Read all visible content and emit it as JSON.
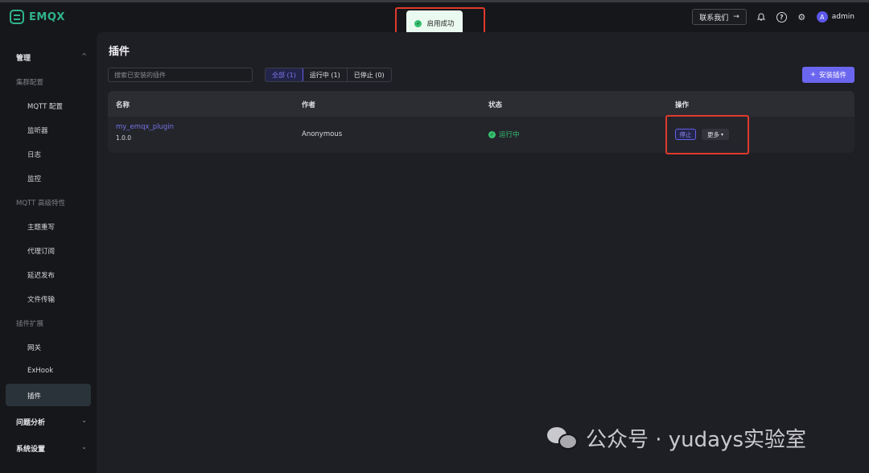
{
  "app": {
    "name": "EMQX"
  },
  "header": {
    "contact_label": "联系我们",
    "user": "admin",
    "avatar_letter": "A"
  },
  "toast": {
    "message": "启用成功"
  },
  "sidebar": {
    "group_manage": "管理",
    "section_cluster": "集群配置",
    "items_cluster": [
      "MQTT 配置",
      "监听器",
      "日志",
      "监控"
    ],
    "section_mqtt": "MQTT 高级特性",
    "items_mqtt": [
      "主题重写",
      "代理订阅",
      "延迟发布",
      "文件传输"
    ],
    "section_plugins": "插件扩展",
    "items_plugins": [
      "网关",
      "ExHook",
      "插件"
    ],
    "active": "插件",
    "group_analysis": "问题分析",
    "group_settings": "系统设置"
  },
  "main": {
    "title": "插件",
    "search_placeholder": "搜索已安装的插件",
    "tabs": [
      "全部 (1)",
      "运行中 (1)",
      "已停止 (0)"
    ],
    "active_tab": 0,
    "install_label": "安装插件",
    "table": {
      "headers": [
        "名称",
        "作者",
        "状态",
        "操作"
      ],
      "rows": [
        {
          "name": "my_emqx_plugin",
          "version": "1.0.0",
          "author": "Anonymous",
          "status": "运行中",
          "stop_label": "停止",
          "more_label": "更多"
        }
      ]
    }
  },
  "watermark": {
    "text": "公众号 · yudays实验室"
  },
  "colors": {
    "accent": "#6b66ef",
    "brand": "#2fb48a",
    "running": "#35c06f",
    "highlight": "#e03a2c"
  }
}
